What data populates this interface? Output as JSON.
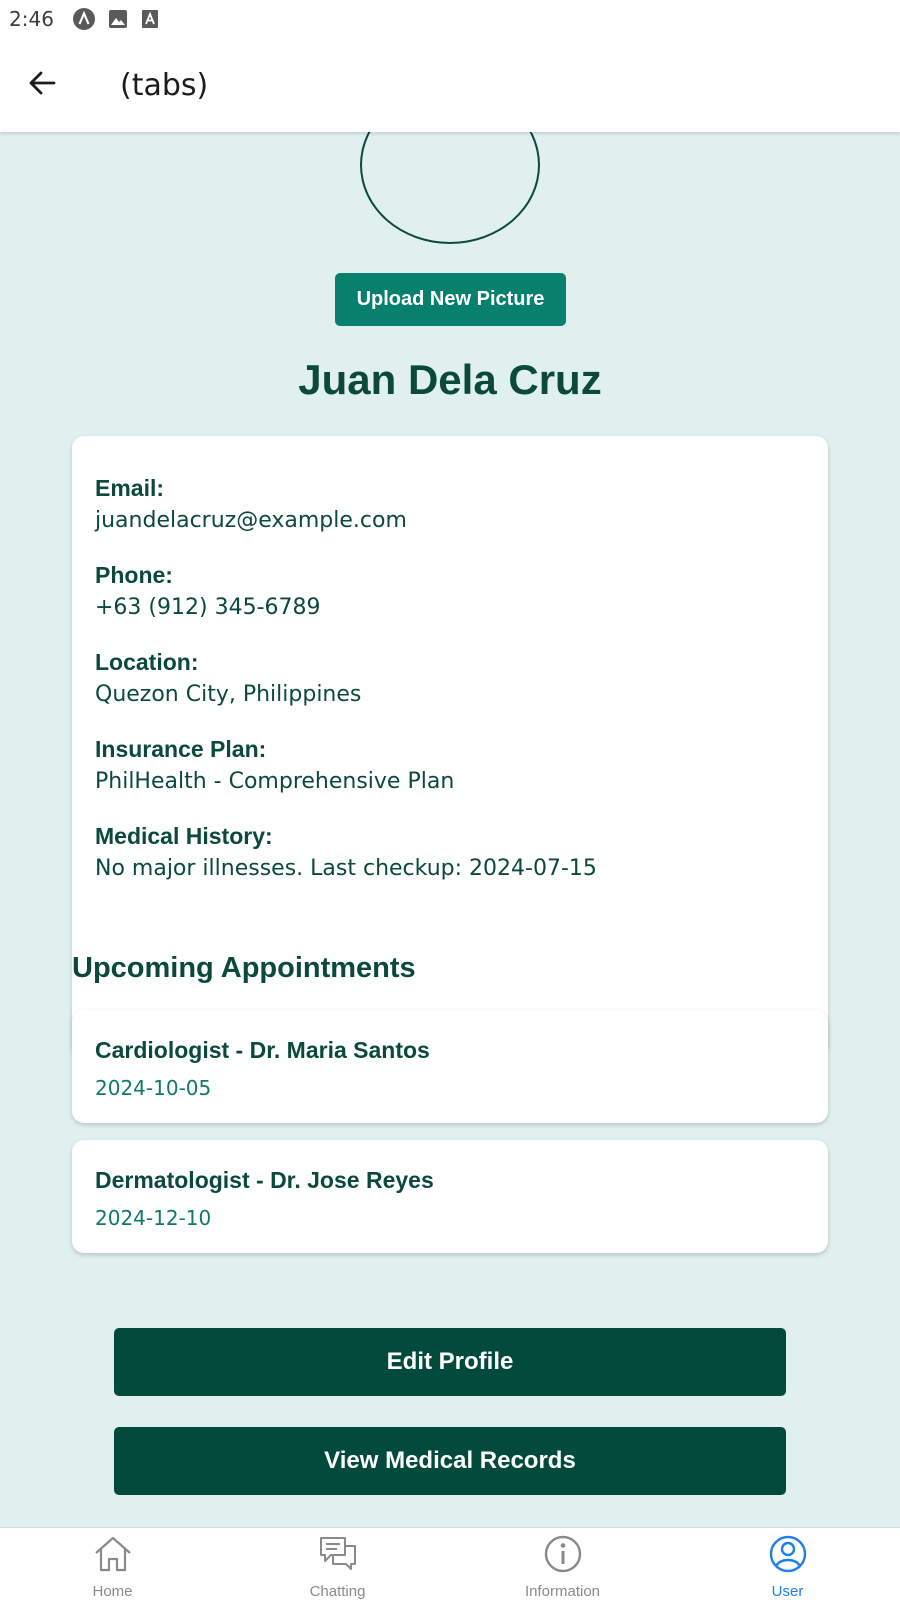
{
  "status_bar": {
    "time": "2:46",
    "icons": [
      "a-circle-icon",
      "image-icon",
      "font-a-icon"
    ]
  },
  "header": {
    "back_icon": "arrow-left-icon",
    "title": "(tabs)"
  },
  "profile": {
    "upload_label": "Upload New Picture",
    "name": "Juan Dela Cruz"
  },
  "info": [
    {
      "label": "Email:",
      "value": "juandelacruz@example.com"
    },
    {
      "label": "Phone:",
      "value": "+63 (912) 345-6789"
    },
    {
      "label": "Location:",
      "value": "Quezon City, Philippines"
    },
    {
      "label": "Insurance Plan:",
      "value": "PhilHealth - Comprehensive Plan"
    },
    {
      "label": "Medical History:",
      "value": "No major illnesses. Last checkup: 2024-07-15"
    }
  ],
  "appointments": {
    "title": "Upcoming Appointments",
    "items": [
      {
        "title": "Cardiologist - Dr. Maria Santos",
        "date": "2024-10-05"
      },
      {
        "title": "Dermatologist - Dr. Jose Reyes",
        "date": "2024-12-10"
      }
    ]
  },
  "actions": {
    "edit_label": "Edit Profile",
    "records_label": "View Medical Records"
  },
  "nav": {
    "items": [
      {
        "label": "Home",
        "icon": "home-icon"
      },
      {
        "label": "Chatting",
        "icon": "chat-icon"
      },
      {
        "label": "Information",
        "icon": "info-icon"
      },
      {
        "label": "User",
        "icon": "user-icon"
      }
    ],
    "active_index": 3
  },
  "colors": {
    "primary_dark": "#024a3c",
    "accent_teal": "#08806e",
    "background": "#e0f0ef",
    "active_tab": "#1e80e6"
  }
}
